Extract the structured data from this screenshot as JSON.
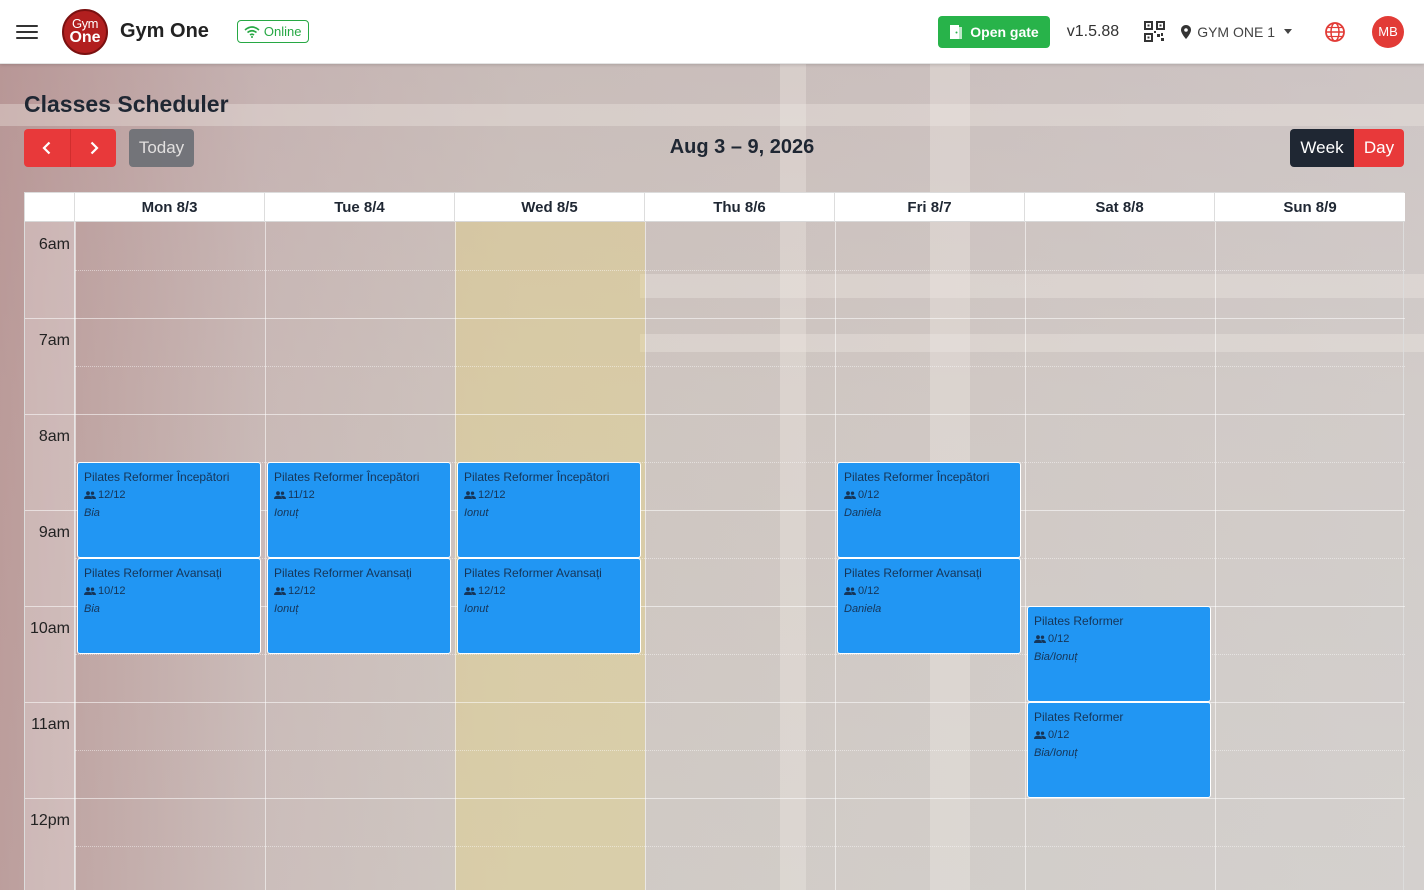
{
  "header": {
    "app_title": "Gym One",
    "logo_line1": "Gym",
    "logo_line2": "One",
    "status_badge": "Online",
    "open_gate_label": "Open gate",
    "version": "v1.5.88",
    "location": "GYM ONE 1",
    "avatar_initials": "MB",
    "colors": {
      "accent": "#e8393a",
      "success": "#28b34a",
      "dark": "#1f2733",
      "event": "#2196f3"
    }
  },
  "page": {
    "title": "Classes Scheduler",
    "today_label": "Today",
    "date_range": "Aug 3 – 9, 2026",
    "view_week": "Week",
    "view_day": "Day"
  },
  "calendar": {
    "days": [
      "Mon 8/3",
      "Tue 8/4",
      "Wed 8/5",
      "Thu 8/6",
      "Fri 8/7",
      "Sat 8/8",
      "Sun 8/9"
    ],
    "hours": [
      "6am",
      "7am",
      "8am",
      "9am",
      "10am",
      "11am",
      "12pm"
    ],
    "events": [
      {
        "title": "Pilates Reformer Începători",
        "capacity": "12/12",
        "trainer": "Bia"
      },
      {
        "title": "Pilates Reformer Avansați",
        "capacity": "10/12",
        "trainer": "Bia"
      },
      {
        "title": "Pilates Reformer Începători",
        "capacity": "11/12",
        "trainer": "Ionuț"
      },
      {
        "title": "Pilates Reformer Avansați",
        "capacity": "12/12",
        "trainer": "Ionuț"
      },
      {
        "title": "Pilates Reformer Începători",
        "capacity": "12/12",
        "trainer": "Ionut"
      },
      {
        "title": "Pilates Reformer Avansați",
        "capacity": "12/12",
        "trainer": "Ionut"
      },
      {
        "title": "Pilates Reformer Începători",
        "capacity": "0/12",
        "trainer": "Daniela"
      },
      {
        "title": "Pilates Reformer Avansați",
        "capacity": "0/12",
        "trainer": "Daniela"
      },
      {
        "title": "Pilates Reformer",
        "capacity": "0/12",
        "trainer": "Bia/Ionuț"
      },
      {
        "title": "Pilates Reformer",
        "capacity": "0/12",
        "trainer": "Bia/Ionuț"
      }
    ]
  }
}
